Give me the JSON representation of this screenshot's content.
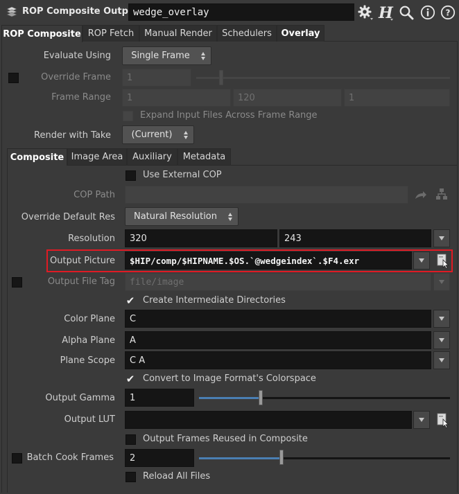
{
  "header": {
    "node_type": "ROP Composite Output",
    "node_name": "wedge_overlay"
  },
  "main_tabs": [
    {
      "label": "ROP Composite",
      "active": true
    },
    {
      "label": "ROP Fetch",
      "active": false
    },
    {
      "label": "Manual Render",
      "active": false
    },
    {
      "label": "Schedulers",
      "active": false
    },
    {
      "label": "Overlay",
      "active": false
    }
  ],
  "params": {
    "evaluate_using": {
      "label": "Evaluate Using",
      "value": "Single Frame"
    },
    "override_frame": {
      "label": "Override Frame",
      "value": "1"
    },
    "frame_range": {
      "label": "Frame Range",
      "start": "1",
      "end": "120",
      "inc": "1"
    },
    "expand_input": {
      "label": "Expand Input Files Across Frame Range"
    },
    "render_with_take": {
      "label": "Render with Take",
      "value": "(Current)"
    }
  },
  "sub_tabs": [
    {
      "label": "Composite",
      "active": true
    },
    {
      "label": "Image Area",
      "active": false
    },
    {
      "label": "Auxiliary",
      "active": false
    },
    {
      "label": "Metadata",
      "active": false
    }
  ],
  "composite": {
    "use_external_cop": {
      "label": "Use External COP",
      "checked": false
    },
    "cop_path": {
      "label": "COP Path",
      "value": ""
    },
    "override_res": {
      "label": "Override Default Res",
      "value": "Natural Resolution"
    },
    "resolution": {
      "label": "Resolution",
      "x": "320",
      "y": "243"
    },
    "output_picture": {
      "label": "Output Picture",
      "value": "$HIP/comp/$HIPNAME.$OS.`@wedgeindex`.$F4.exr"
    },
    "output_file_tag": {
      "label": "Output File Tag",
      "placeholder": "file/image"
    },
    "create_dirs": {
      "label": "Create Intermediate Directories",
      "checked": true
    },
    "color_plane": {
      "label": "Color Plane",
      "value": "C"
    },
    "alpha_plane": {
      "label": "Alpha Plane",
      "value": "A"
    },
    "plane_scope": {
      "label": "Plane Scope",
      "value": "C A"
    },
    "convert_colorspace": {
      "label": "Convert to Image Format's Colorspace",
      "checked": true
    },
    "output_gamma": {
      "label": "Output Gamma",
      "value": "1",
      "slider_fraction": 0.25
    },
    "output_lut": {
      "label": "Output LUT",
      "value": ""
    },
    "frames_reused": {
      "label": "Output Frames Reused in Composite",
      "checked": false
    },
    "batch_cook": {
      "label": "Batch Cook Frames",
      "value": "2",
      "slider_fraction": 0.33
    },
    "reload_files": {
      "label": "Reload All Files",
      "checked": false
    }
  },
  "colors": {
    "highlight": "#e01b24",
    "slider_fill": "#4a7fb3",
    "background": "#3a3a3a"
  },
  "icons": [
    "rop-node-icon",
    "gear-icon",
    "houdini-help-icon",
    "search-icon",
    "info-icon",
    "help-icon",
    "file-chooser-icon",
    "jump-arrow-icon",
    "node-chooser-icon"
  ]
}
